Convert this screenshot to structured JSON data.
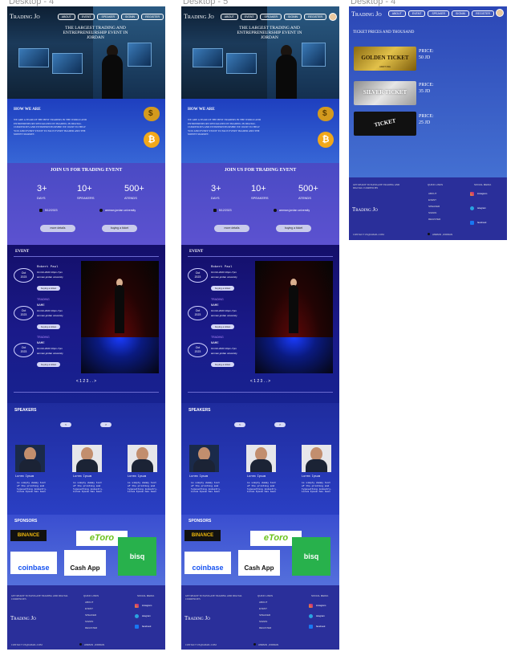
{
  "frames": {
    "f1": "Desktop - 4",
    "f2": "Desktop - 5",
    "f3": "Desktop - 4"
  },
  "site": {
    "logo": "Trading Jo",
    "nav": [
      "ABOUT",
      "EVENT",
      "SPEAKER",
      "SIGNIN",
      "REGISTER"
    ],
    "hero_title": "The largest trading and entrepreneurship event in Jordan"
  },
  "how": {
    "title": "HOW WE ARE",
    "text": "We are a team of the best traders in the world and entrepreneurs specialized in trading in digital currencies and entrepreneurship. We want to help you and every study to face every trader and the money market."
  },
  "join": {
    "title": "JOIN US FOR TRADING EVENT",
    "stats": [
      {
        "value": "3+",
        "label": "DAYS"
      },
      {
        "value": "10+",
        "label": "SPEAKERS"
      },
      {
        "value": "500+",
        "label": "ATENDS"
      }
    ],
    "date": "5/12/2023",
    "location": "amman,jordan university",
    "more_label": "more details",
    "buy_label": "buying a ticket"
  },
  "event": {
    "title": "EVENT",
    "items": [
      {
        "date_a": "Oct",
        "date_b": "2023",
        "name": "Robert Paul",
        "time": "10-Oct-2023",
        "hour": "10pm-7pm",
        "place": "amman,jordan university",
        "button": "buying a ticket",
        "tag": ""
      },
      {
        "date_a": "Oct",
        "date_b": "2023",
        "name": "NAME",
        "time": "10-Oct-2023",
        "hour": "10pm-7pm",
        "place": "amman,jordan university",
        "button": "buying a ticket",
        "tag": "TRADING"
      },
      {
        "date_a": "Oct",
        "date_b": "2023",
        "name": "NAME",
        "time": "10-Oct-2023",
        "hour": "10pm-7pm",
        "place": "amman,jordan university",
        "button": "buying a ticket",
        "tag": "TRADING"
      }
    ],
    "pager": "< 1 2 3 . . >"
  },
  "speakers": {
    "title": "SPEAKERS",
    "prev": "<",
    "next": ">",
    "list": [
      {
        "name": "Lorem Ipsum",
        "desc": "is simply dummy text of the printing and typesetting industry. Lorem Ipsum has been"
      },
      {
        "name": "Lorem Ipsum",
        "desc": "is simply dummy text of the printing and typesetting industry. Lorem Ipsum has been"
      },
      {
        "name": "Lorem Ipsum",
        "desc": "is simply dummy text of the printing and typesetting industry. Lorem Ipsum has been"
      }
    ]
  },
  "sponsors": {
    "title": "SPONSORS",
    "names": [
      "BINANCE",
      "eToro",
      "coinbase",
      "Cash App",
      "bisq"
    ]
  },
  "footer": {
    "tagline": "GET READY TO NAVIGATE TRADING AND DIGITAL CURRENCIES",
    "quick_title": "QUICK LINKS",
    "quick_links": [
      "ABOUT",
      "EVENT",
      "SPEAKER",
      "SIGNIN",
      "REGISTER"
    ],
    "social_title": "SOCIAL MEDIA",
    "social": [
      "instagram",
      "telegram",
      "facebook"
    ],
    "contact": "CONTACT US@GMAIL.COM",
    "location": "amman ,jordan",
    "logo": "Trading Jo"
  },
  "tickets": {
    "title": "TICKET PRICES AND THOUSAND",
    "items": [
      {
        "label": "GOLDEN TICKET",
        "sub": "ADMIT ONE",
        "price_label": "PRICE:",
        "price": "50 JD",
        "color": "#c9a024"
      },
      {
        "label": "SILVER TICKET",
        "sub": "",
        "price_label": "PRICE:",
        "price": "35 JD",
        "color": "#bfbfbf"
      },
      {
        "label": "TICKET",
        "sub": "",
        "price_label": "PRICE:",
        "price": "25 JD",
        "color": "#111111"
      }
    ]
  }
}
